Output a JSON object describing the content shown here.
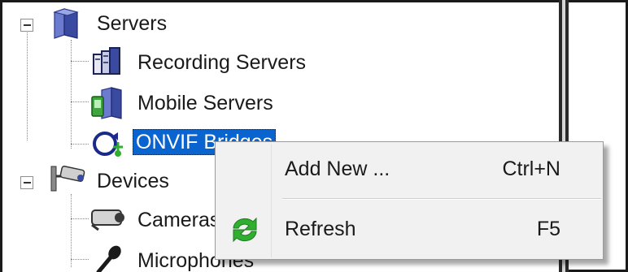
{
  "tree": {
    "servers": {
      "label": "Servers",
      "icon": "server-group-icon",
      "children": [
        {
          "label": "Recording Servers",
          "icon": "recording-servers-icon"
        },
        {
          "label": "Mobile Servers",
          "icon": "mobile-servers-icon"
        },
        {
          "label": "ONVIF Bridges",
          "icon": "onvif-bridge-icon",
          "selected": true
        }
      ]
    },
    "devices": {
      "label": "Devices",
      "icon": "security-camera-icon",
      "children": [
        {
          "label": "Cameras",
          "icon": "camera-icon"
        },
        {
          "label": "Microphones",
          "icon": "microphone-icon"
        }
      ]
    }
  },
  "context_menu": {
    "items": [
      {
        "label": "Add New ...",
        "shortcut": "Ctrl+N",
        "icon": null
      },
      {
        "label": "Refresh",
        "shortcut": "F5",
        "icon": "refresh-icon"
      }
    ]
  },
  "colors": {
    "selection": "#0a64cf",
    "menu_background": "#f1f1f1",
    "refresh_green": "#2fae2f",
    "server_blue": "#3a4aa0"
  }
}
